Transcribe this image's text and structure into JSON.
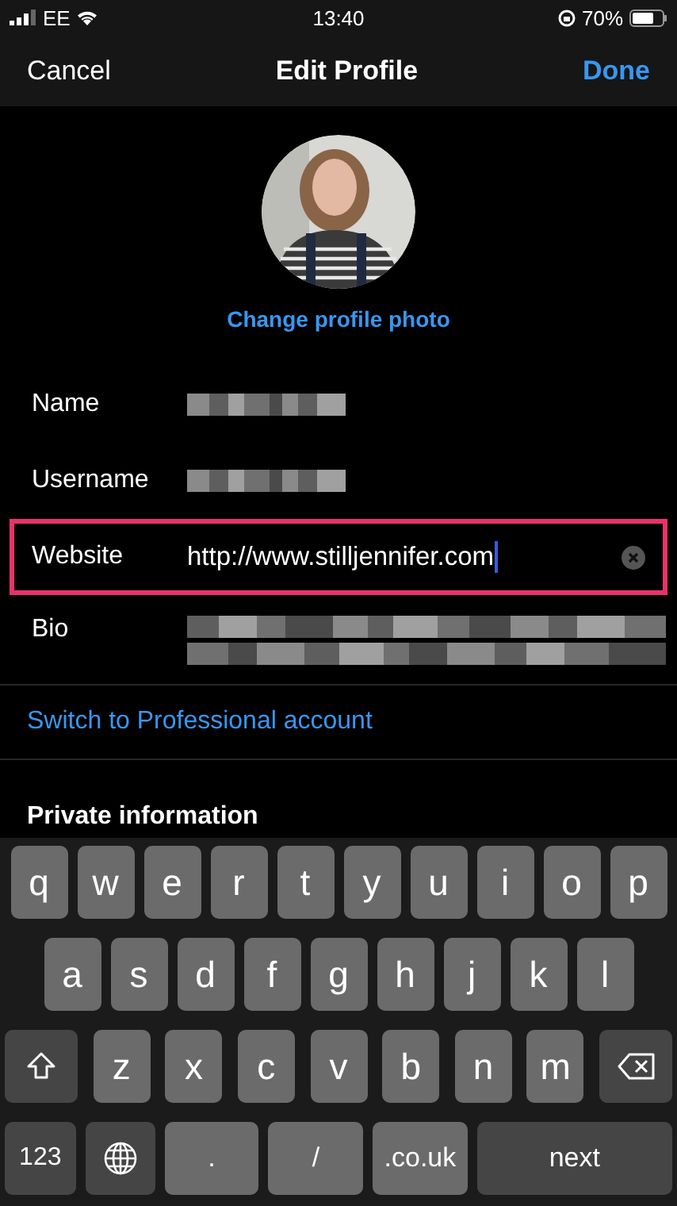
{
  "status_bar": {
    "carrier": "EE",
    "time": "13:40",
    "battery": "70%"
  },
  "nav": {
    "cancel": "Cancel",
    "title": "Edit Profile",
    "done": "Done"
  },
  "profile": {
    "change_photo": "Change profile photo"
  },
  "fields": [
    {
      "label": "Name",
      "kind": "redacted",
      "focused": false
    },
    {
      "label": "Username",
      "kind": "redacted",
      "focused": false
    },
    {
      "label": "Website",
      "kind": "text",
      "value": "http://www.stilljennifer.com",
      "focused": true
    },
    {
      "label": "Bio",
      "kind": "redacted_multiline",
      "focused": false
    }
  ],
  "switch_link": "Switch to Professional account",
  "section_heading": "Private information",
  "keyboard": {
    "rows": [
      {
        "keys": [
          {
            "kind": "letter",
            "label": "q"
          },
          {
            "kind": "letter",
            "label": "w"
          },
          {
            "kind": "letter",
            "label": "e"
          },
          {
            "kind": "letter",
            "label": "r"
          },
          {
            "kind": "letter",
            "label": "t"
          },
          {
            "kind": "letter",
            "label": "y"
          },
          {
            "kind": "letter",
            "label": "u"
          },
          {
            "kind": "letter",
            "label": "i"
          },
          {
            "kind": "letter",
            "label": "o"
          },
          {
            "kind": "letter",
            "label": "p"
          }
        ]
      },
      {
        "keys": [
          {
            "kind": "letter",
            "label": "a"
          },
          {
            "kind": "letter",
            "label": "s"
          },
          {
            "kind": "letter",
            "label": "d"
          },
          {
            "kind": "letter",
            "label": "f"
          },
          {
            "kind": "letter",
            "label": "g"
          },
          {
            "kind": "letter",
            "label": "h"
          },
          {
            "kind": "letter",
            "label": "j"
          },
          {
            "kind": "letter",
            "label": "k"
          },
          {
            "kind": "letter",
            "label": "l"
          }
        ]
      },
      {
        "keys": [
          {
            "kind": "shift"
          },
          {
            "kind": "letter",
            "label": "z"
          },
          {
            "kind": "letter",
            "label": "x"
          },
          {
            "kind": "letter",
            "label": "c"
          },
          {
            "kind": "letter",
            "label": "v"
          },
          {
            "kind": "letter",
            "label": "b"
          },
          {
            "kind": "letter",
            "label": "n"
          },
          {
            "kind": "letter",
            "label": "m"
          },
          {
            "kind": "delete"
          }
        ]
      },
      {
        "keys": [
          {
            "kind": "mode",
            "label": "123"
          },
          {
            "kind": "globe"
          },
          {
            "kind": "wide",
            "label": "."
          },
          {
            "kind": "wide",
            "label": "/"
          },
          {
            "kind": "wide",
            "label": ".co.uk"
          },
          {
            "kind": "action",
            "label": "next"
          }
        ]
      }
    ]
  }
}
